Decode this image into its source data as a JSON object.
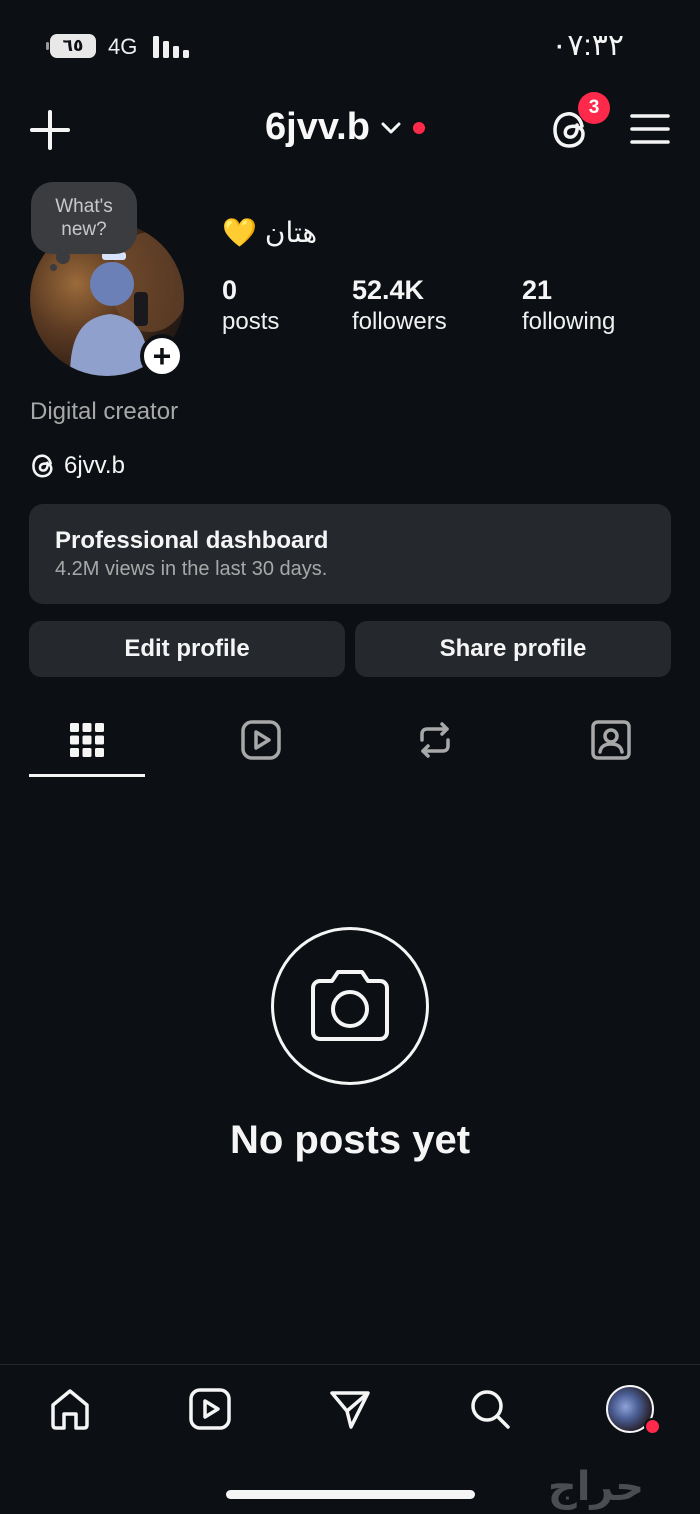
{
  "status_bar": {
    "battery": "٦٥",
    "network": "4G",
    "time": "٠٧:٣٢"
  },
  "header": {
    "username": "6jvv.b",
    "threads_badge": "3"
  },
  "profile": {
    "note_text": "What's new?",
    "display_name": "هتان",
    "display_emoji": "💛",
    "stats": [
      {
        "value": "0",
        "label": "posts"
      },
      {
        "value": "52.4K",
        "label": "followers"
      },
      {
        "value": "21",
        "label": "following"
      }
    ],
    "category": "Digital creator",
    "threads_handle": "6jvv.b"
  },
  "dashboard": {
    "title": "Professional dashboard",
    "subtitle": "4.2M views in the last 30 days."
  },
  "buttons": {
    "edit": "Edit profile",
    "share": "Share profile"
  },
  "tabs": {
    "icons": [
      "grid-icon",
      "reels-icon",
      "reposts-icon",
      "tagged-icon"
    ],
    "selected": "grid-icon"
  },
  "empty_state": {
    "text": "No posts yet"
  },
  "bottom_nav": {
    "icons": [
      "home-icon",
      "reels-icon",
      "messages-icon",
      "search-icon",
      "profile-avatar"
    ]
  },
  "watermark": {
    "text": "حراج"
  },
  "colors": {
    "background": "#0c1014",
    "card": "#25292e",
    "badge": "#ff2a4b",
    "text": "#f5f5f5",
    "muted": "#a8a8a8"
  }
}
